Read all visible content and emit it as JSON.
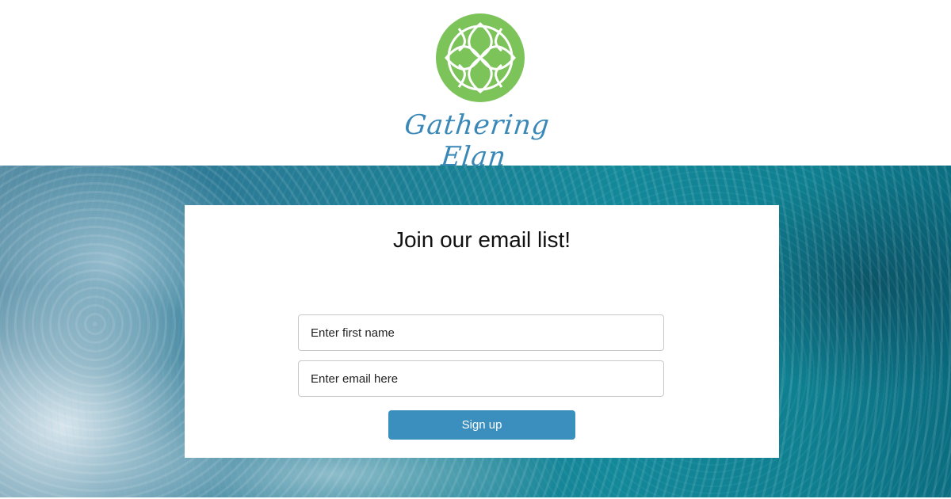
{
  "brand": {
    "name": "Gathering Elan",
    "logo_icon": "flower-lattice-logo-icon",
    "logo_color": "#7cc35a",
    "text_color": "#3a88b8"
  },
  "hero": {
    "background": "ocean-waves-image"
  },
  "signup_form": {
    "title": "Join our email list!",
    "first_name_placeholder": "Enter first name",
    "email_placeholder": "Enter email here",
    "submit_label": "Sign up",
    "button_color": "#3a8fbf"
  }
}
